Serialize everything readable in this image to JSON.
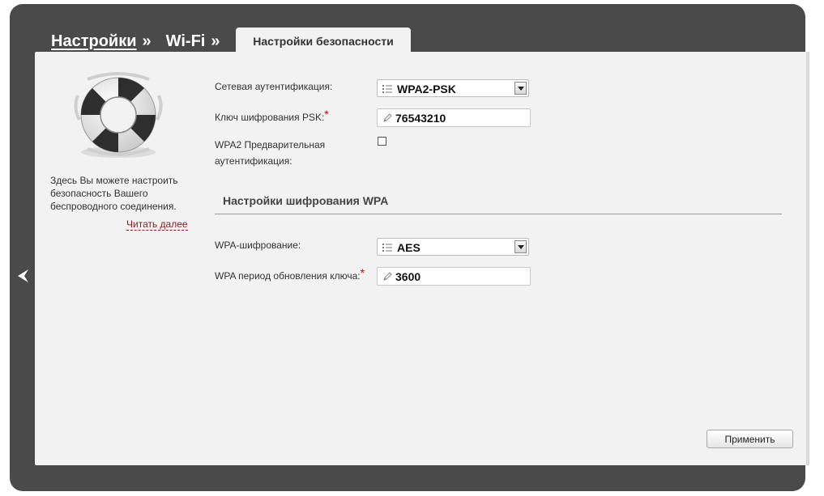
{
  "breadcrumb": {
    "items": [
      {
        "label": "Настройки",
        "sep": "»"
      },
      {
        "label": "Wi-Fi",
        "sep": "»"
      }
    ],
    "active_tab": "Настройки безопасности"
  },
  "info": {
    "icon": "lifebuoy-icon",
    "description": "Здесь Вы можете настроить безопасность Вашего беспроводного соединения.",
    "read_more": "Читать далее"
  },
  "form": {
    "auth": {
      "label": "Сетевая аутентификация:",
      "value": "WPA2-PSK"
    },
    "psk": {
      "label": "Ключ шифрования PSK:",
      "required_mark": "*",
      "value": "76543210"
    },
    "preauth": {
      "label_line1": "WPA2 Предварительная",
      "label_line2": "аутентификация:",
      "checked": false
    },
    "wpa_section": {
      "title": "Настройки шифрования WPA"
    },
    "wpa_encryption": {
      "label": "WPA-шифрование:",
      "value": "AES"
    },
    "key_update": {
      "label": "WPA период обновления ключа:",
      "required_mark": "*",
      "value": "3600"
    }
  },
  "actions": {
    "apply_label": "Применить"
  },
  "colors": {
    "frame": "#4a4a4a",
    "panel": "#f2f2f2",
    "link": "#8b1a1a",
    "required": "#cc0000"
  }
}
